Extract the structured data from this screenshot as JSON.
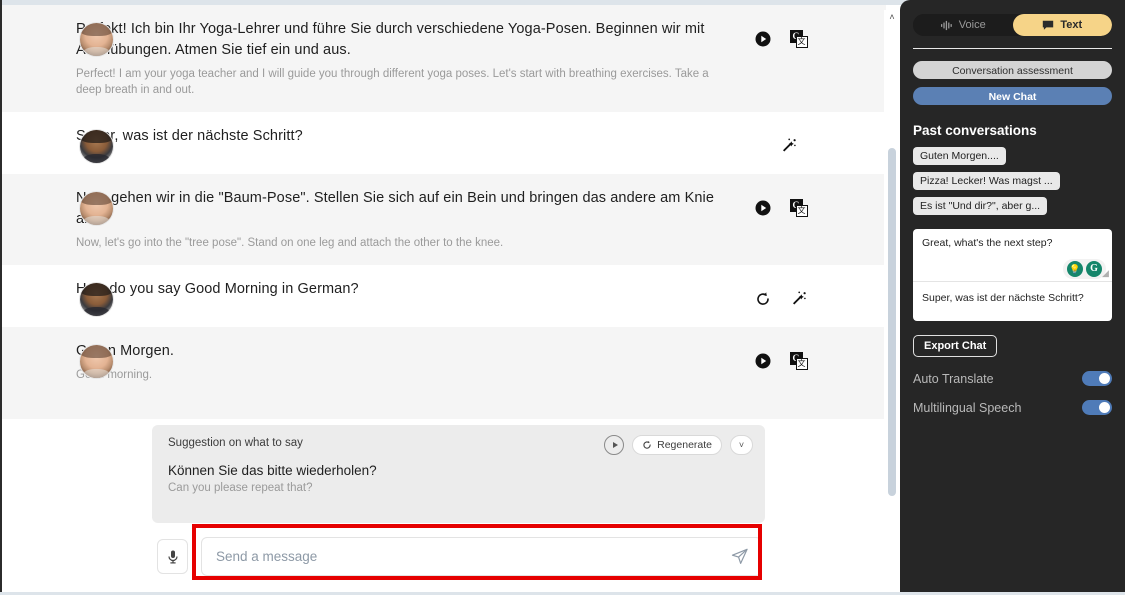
{
  "messages": [
    {
      "role": "assistant",
      "avatar": "assistant-avatar",
      "primary": "Perfekt! Ich bin Ihr Yoga-Lehrer und führe Sie durch verschiedene Yoga-Posen. Beginnen wir mit Atemübungen. Atmen Sie tief ein und aus.",
      "secondary": "Perfect! I am your yoga teacher and I will guide you through different yoga poses. Let's start with breathing exercises. Take a deep breath in and out.",
      "actions": [
        "play-icon",
        "translate-icon"
      ]
    },
    {
      "role": "user",
      "avatar": "user-avatar",
      "primary": "Super, was ist der nächste Schritt?",
      "secondary": "",
      "actions": [
        "magic-wand-icon"
      ]
    },
    {
      "role": "assistant",
      "avatar": "assistant-avatar",
      "primary": "Nun, gehen wir in die \"Baum-Pose\". Stellen Sie sich auf ein Bein und bringen das andere am Knie an.",
      "secondary": "Now, let's go into the \"tree pose\". Stand on one leg and attach the other to the knee.",
      "actions": [
        "play-icon",
        "translate-icon"
      ]
    },
    {
      "role": "user",
      "avatar": "user-avatar",
      "primary": "How do you say Good Morning in German?",
      "secondary": "",
      "actions": [
        "regenerate-icon",
        "magic-wand-icon"
      ]
    },
    {
      "role": "assistant",
      "avatar": "assistant-avatar",
      "primary": "Guten Morgen.",
      "secondary": "Good morning.",
      "actions": [
        "play-icon",
        "translate-icon"
      ]
    }
  ],
  "suggestion": {
    "title": "Suggestion on what to say",
    "primary": "Können Sie das bitte wiederholen?",
    "secondary": "Can you please repeat that?",
    "regenerate_label": "Regenerate",
    "chevron": "˅",
    "play_icon": "play-circle-icon",
    "regenerate_icon": "refresh-icon"
  },
  "composer": {
    "mic_icon": "microphone-icon",
    "placeholder": "Send a message",
    "value": "",
    "send_icon": "send-icon",
    "highlight_color": "#e60000"
  },
  "scrollbar": {
    "up_arrow": "˄"
  },
  "sidebar": {
    "mode_tabs": [
      {
        "label": "Voice",
        "icon": "waveform-icon",
        "active": false
      },
      {
        "label": "Text",
        "icon": "chat-bubble-icon",
        "active": true
      }
    ],
    "assessment_label": "Conversation assessment",
    "new_chat_label": "New Chat",
    "past_heading": "Past conversations",
    "past_conversations": [
      "Guten Morgen....",
      "Pizza! Lecker! Was magst ...",
      "Es ist \"Und dir?\", aber g..."
    ],
    "grammarly": {
      "input_value": "Great, what's the next step?",
      "translation": "Super, was ist der nächste Schritt?",
      "bulb_icon": "lightbulb-icon",
      "grammarly_icon": "grammarly-g-icon",
      "accent": "#15866b"
    },
    "export_label": "Export Chat",
    "switches": [
      {
        "label": "Auto Translate",
        "on": true
      },
      {
        "label": "Multilingual Speech",
        "on": true
      }
    ],
    "accent_active": "#f6d488",
    "accent_newchat": "#5b80b4",
    "background": "#262626"
  }
}
